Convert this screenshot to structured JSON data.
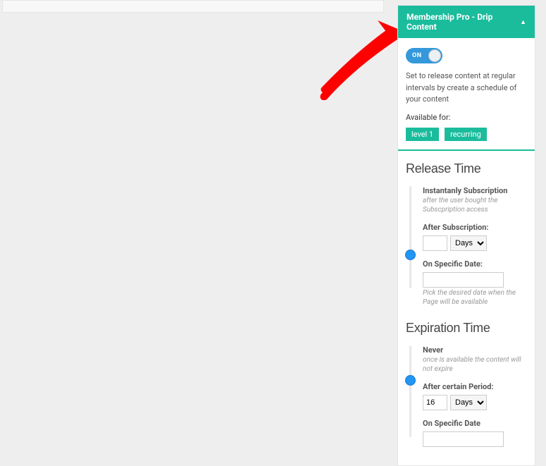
{
  "panel": {
    "title": "Membership Pro - Drip Content",
    "toggle": {
      "state": "ON"
    },
    "description": "Set to release content at regular intervals by create a schedule of your content",
    "available_label": "Available for:",
    "tags": [
      "level 1",
      "recurring"
    ]
  },
  "release": {
    "title": "Release Time",
    "option1": {
      "title": "Instantanly Subscription",
      "hint": "after the user bought the Subscpription access",
      "after_label": "After Subscription:",
      "after_value": "",
      "unit": "Days"
    },
    "option2": {
      "title": "On Specific Date:",
      "value": "",
      "hint": "Pick the desired date when the Page will be available"
    }
  },
  "expiration": {
    "title": "Expiration Time",
    "option1": {
      "title": "Never",
      "hint": "once is available the content will not expire"
    },
    "option2": {
      "title": "After certain Period:",
      "value": "16",
      "unit": "Days"
    },
    "option3": {
      "title": "On Specific Date",
      "value": ""
    }
  }
}
